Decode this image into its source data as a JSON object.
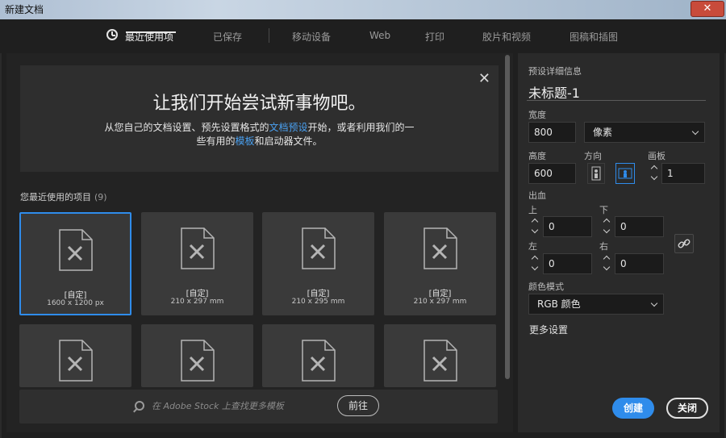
{
  "window": {
    "title": "新建文档",
    "close_glyph": "✕"
  },
  "tabs": [
    {
      "label": "最近使用项",
      "active": true
    },
    {
      "label": "已保存"
    },
    {
      "label": "移动设备"
    },
    {
      "label": "Web"
    },
    {
      "label": "打印"
    },
    {
      "label": "胶片和视频"
    },
    {
      "label": "图稿和插图"
    }
  ],
  "banner": {
    "title": "让我们开始尝试新事物吧。",
    "line1_a": "从您自己的文档设置、预先设置格式的",
    "line1_link": "文档预设",
    "line1_b": "开始，或者利用我们的一",
    "line2_a": "些有用的",
    "line2_link": "模板",
    "line2_b": "和启动器文件。",
    "close_glyph": "✕"
  },
  "recent": {
    "label": "您最近使用的项目",
    "count": "(9)",
    "items": [
      {
        "name": "[自定]",
        "size": "1600 x 1200 px",
        "selected": true
      },
      {
        "name": "[自定]",
        "size": "210 x 297 mm"
      },
      {
        "name": "[自定]",
        "size": "210 x 295 mm"
      },
      {
        "name": "[自定]",
        "size": "210 x 297 mm"
      }
    ]
  },
  "stock": {
    "placeholder": "在 Adobe Stock 上查找更多模板",
    "go_label": "前往"
  },
  "preset": {
    "section_label": "预设详细信息",
    "doc_name": "未标题-1",
    "width_label": "宽度",
    "width_value": "800",
    "unit": "像素",
    "height_label": "高度",
    "height_value": "600",
    "orientation_label": "方向",
    "artboards_label": "画板",
    "artboards_value": "1",
    "bleed_label": "出血",
    "top_label": "上",
    "top_value": "0",
    "bottom_label": "下",
    "bottom_value": "0",
    "left_label": "左",
    "left_value": "0",
    "right_label": "右",
    "right_value": "0",
    "color_mode_label": "颜色模式",
    "color_mode": "RGB 颜色",
    "more_settings": "更多设置"
  },
  "actions": {
    "create": "创建",
    "close": "关闭"
  },
  "colors": {
    "accent": "#2f8ceb",
    "panel": "#2a2a2a",
    "background": "#1f1f1f"
  }
}
